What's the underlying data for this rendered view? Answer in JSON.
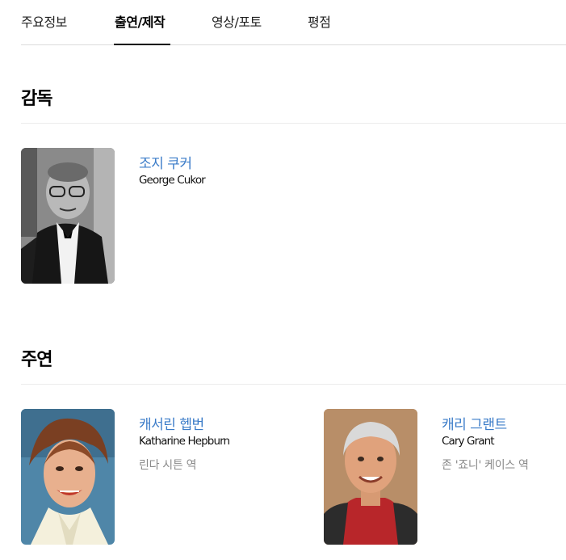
{
  "tabs": [
    {
      "label": "주요정보",
      "active": false
    },
    {
      "label": "출연/제작",
      "active": true
    },
    {
      "label": "영상/포토",
      "active": false
    },
    {
      "label": "평점",
      "active": false
    }
  ],
  "sections": {
    "director": {
      "title": "감독",
      "people": [
        {
          "name_ko": "조지 쿠커",
          "name_en": "George Cukor",
          "role": ""
        }
      ]
    },
    "cast": {
      "title": "주연",
      "people": [
        {
          "name_ko": "캐서린 헵번",
          "name_en": "Katharine Hepburn",
          "role": "린다 시튼 역"
        },
        {
          "name_ko": "캐리 그랜트",
          "name_en": "Cary Grant",
          "role": "존 '죠니' 케이스 역"
        }
      ]
    }
  },
  "colors": {
    "link": "#3a7bc8",
    "role_text": "#8a8a8a",
    "divider": "#ececec"
  }
}
